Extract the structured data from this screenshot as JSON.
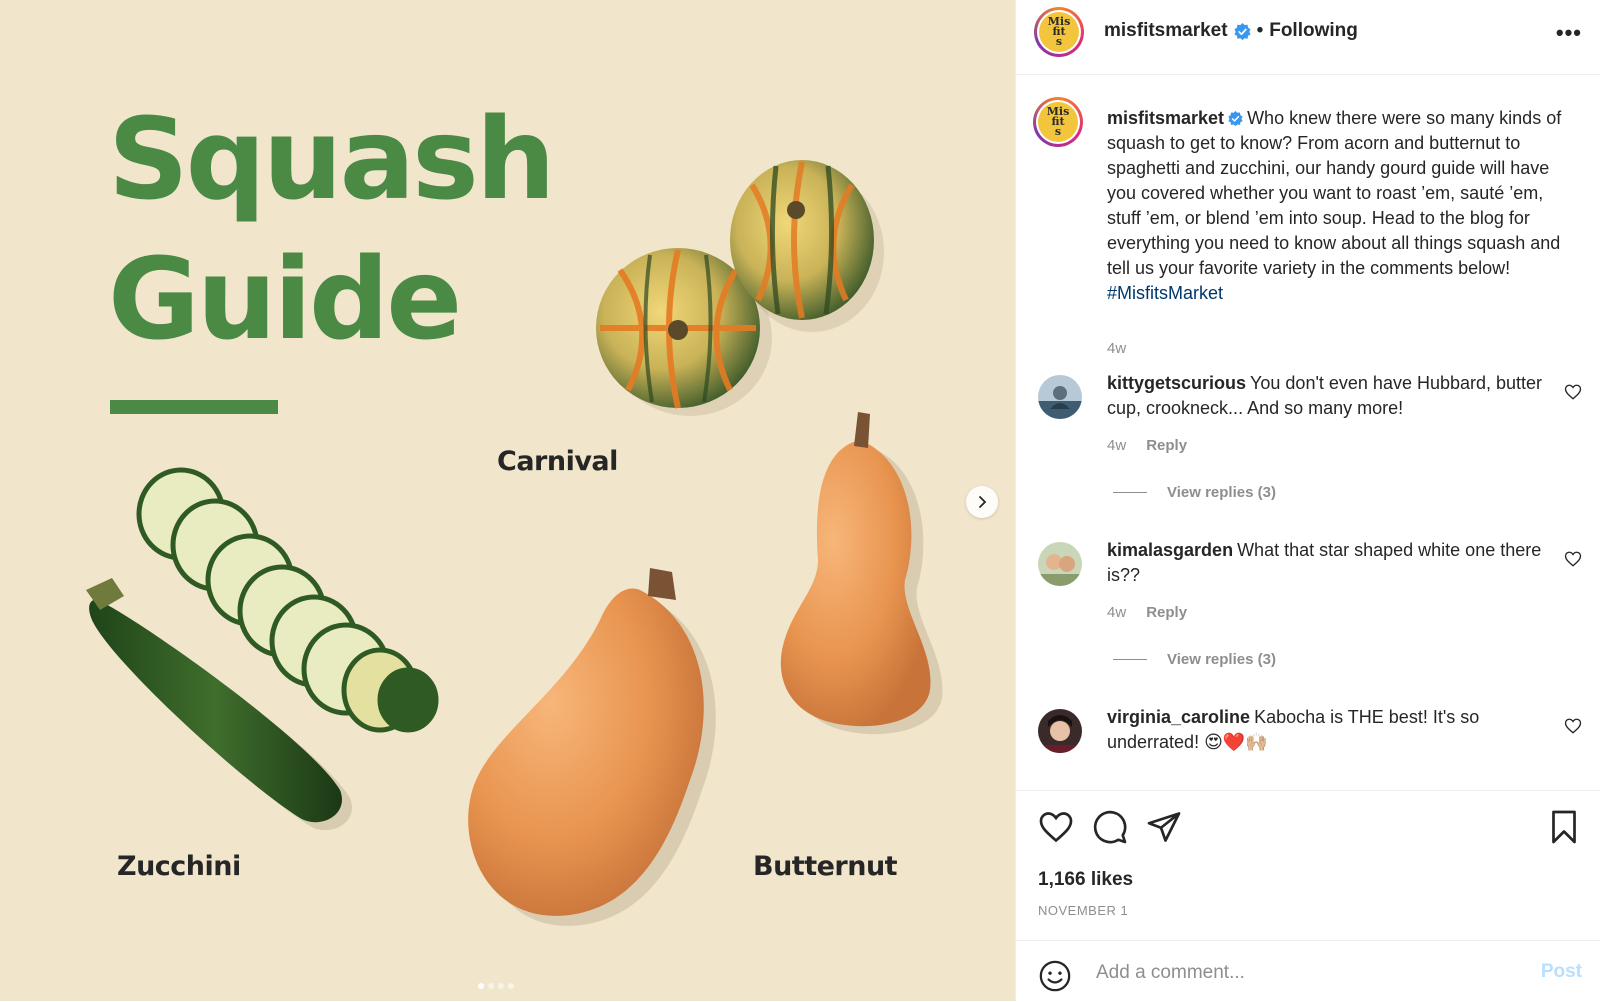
{
  "media": {
    "title_line1": "Squash",
    "title_line2": "Guide",
    "labels": {
      "carnival": "Carnival",
      "zucchini": "Zucchini",
      "butternut": "Butternut"
    },
    "carousel_total": 4,
    "carousel_active": 1,
    "colors": {
      "background": "#f1e6cc",
      "title": "#4a8a45"
    }
  },
  "header": {
    "avatar_text": "Mis fit s",
    "username": "misfitsmarket",
    "separator": "•",
    "follow_status": "Following",
    "more_icon": "more-horizontal-icon"
  },
  "caption": {
    "username": "misfitsmarket",
    "text": "Who knew there were so many kinds of squash to get to know? From acorn and butternut to spaghetti and zucchini, our handy gourd guide will have you covered whether you want to roast ’em, sauté ’em, stuff ’em, or blend ’em into soup. Head to the blog for everything you need to know about all things squash and tell us your favorite variety in the comments below!",
    "hashtag": "#MisfitsMarket",
    "time": "4w"
  },
  "comments": [
    {
      "username": "kittygetscurious",
      "text": "You don't even have Hubbard, butter cup, crookneck... And so many more!",
      "time": "4w",
      "reply_label": "Reply",
      "view_replies": "View replies (3)"
    },
    {
      "username": "kimalasgarden",
      "text": "What that star shaped white one there is??",
      "time": "4w",
      "reply_label": "Reply",
      "view_replies": "View replies (3)"
    },
    {
      "username": "virginia_caroline",
      "text": "Kabocha is THE best! It's so underrated! 😍❤️🙌🏼"
    }
  ],
  "actions": {
    "likes": "1,166 likes",
    "date": "NOVEMBER 1"
  },
  "comment_bar": {
    "placeholder": "Add a comment...",
    "post_label": "Post"
  }
}
